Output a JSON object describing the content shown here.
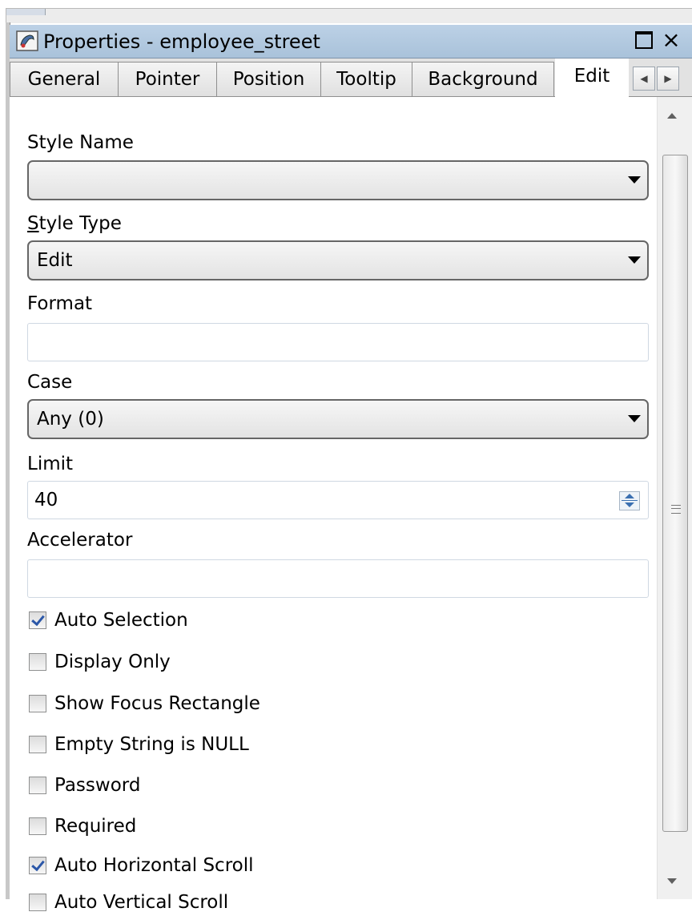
{
  "window": {
    "title": "Properties - employee_street",
    "restore_icon": "restore-icon",
    "close_label": "×"
  },
  "tabs": [
    {
      "label": "General",
      "active": false
    },
    {
      "label": "Pointer",
      "active": false
    },
    {
      "label": "Position",
      "active": false
    },
    {
      "label": "Tooltip",
      "active": false
    },
    {
      "label": "Background",
      "active": false
    },
    {
      "label": "Edit",
      "active": true
    }
  ],
  "form": {
    "style_name": {
      "label": "Style Name",
      "value": ""
    },
    "style_type": {
      "label_prefix": "S",
      "label_rest": "tyle Type",
      "value": "Edit"
    },
    "format": {
      "label": "Format",
      "value": ""
    },
    "case": {
      "label": "Case",
      "value": "Any (0)"
    },
    "limit": {
      "label": "Limit",
      "value": "40"
    },
    "accelerator": {
      "label": "Accelerator",
      "value": ""
    }
  },
  "checkboxes": [
    {
      "label": "Auto Selection",
      "checked": true
    },
    {
      "label": "Display Only",
      "checked": false
    },
    {
      "label": "Show Focus Rectangle",
      "checked": false
    },
    {
      "label": "Empty String is NULL",
      "checked": false
    },
    {
      "label": "Password",
      "checked": false
    },
    {
      "label": "Required",
      "checked": false
    },
    {
      "label": "Auto Horizontal Scroll",
      "checked": true
    },
    {
      "label": "Auto Vertical Scroll",
      "checked": false
    }
  ],
  "colors": {
    "titlebar": "#bcd1e6",
    "check_accent": "#2b57a8"
  }
}
